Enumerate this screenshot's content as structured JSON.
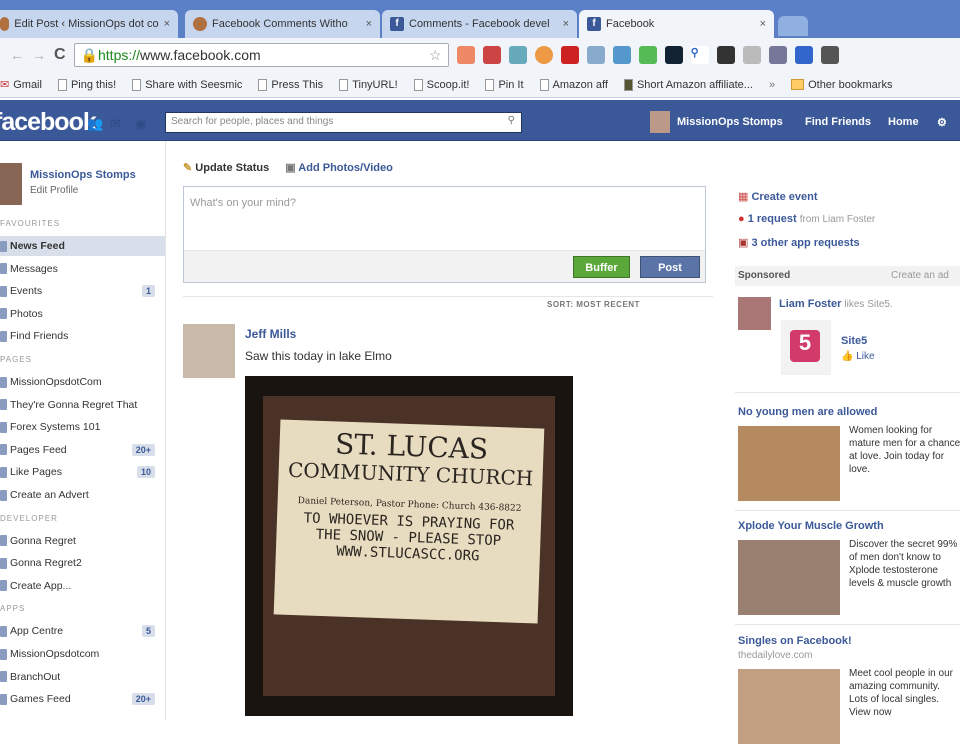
{
  "browser": {
    "tabs": [
      {
        "title": "Edit Post ‹ MissionOps dot co"
      },
      {
        "title": "Facebook Comments Witho"
      },
      {
        "title": "Comments - Facebook devel"
      },
      {
        "title": "Facebook"
      }
    ],
    "url_scheme": "https://",
    "url_rest": "www.facebook.com",
    "bookmarks": [
      "Gmail",
      "Ping this!",
      "Share with Seesmic",
      "Press This",
      "TinyURL!",
      "Scoop.it!",
      "Pin It",
      "Amazon aff",
      "Short Amazon affiliate...",
      "Other bookmarks"
    ]
  },
  "header": {
    "logo": "facebook",
    "search_placeholder": "Search for people, places and things",
    "user": "MissionOps Stomps",
    "find_friends": "Find Friends",
    "home": "Home"
  },
  "sidebar": {
    "profile_name": "MissionOps Stomps",
    "edit_profile": "Edit Profile",
    "sections": [
      {
        "title": "Favourites",
        "items": [
          {
            "label": "News Feed"
          },
          {
            "label": "Messages"
          },
          {
            "label": "Events",
            "count": "1"
          },
          {
            "label": "Photos"
          },
          {
            "label": "Find Friends"
          }
        ]
      },
      {
        "title": "Pages",
        "items": [
          {
            "label": "MissionOpsdotCom"
          },
          {
            "label": "They're Gonna Regret That"
          },
          {
            "label": "Forex Systems 101"
          },
          {
            "label": "Pages Feed",
            "count": "20+"
          },
          {
            "label": "Like Pages",
            "count": "10"
          },
          {
            "label": "Create an Advert"
          }
        ]
      },
      {
        "title": "Developer",
        "items": [
          {
            "label": "Gonna Regret"
          },
          {
            "label": "Gonna Regret2"
          },
          {
            "label": "Create App..."
          }
        ]
      },
      {
        "title": "Apps",
        "items": [
          {
            "label": "App Centre",
            "count": "5"
          },
          {
            "label": "MissionOpsdotcom"
          },
          {
            "label": "BranchOut"
          },
          {
            "label": "Games Feed",
            "count": "20+"
          }
        ]
      }
    ]
  },
  "composer": {
    "update_status": "Update Status",
    "add_photos": "Add Photos/Video",
    "placeholder": "What's on your mind?",
    "buffer": "Buffer",
    "post": "Post"
  },
  "feed": {
    "sort": "SORT: MOST RECENT",
    "post": {
      "author": "Jeff Mills",
      "text": "Saw this today in lake Elmo",
      "photo_sign": [
        "ST. LUCAS",
        "COMMUNITY CHURCH",
        "Daniel Peterson, Pastor  Phone: Church 436-8822",
        "TO WHOEVER IS PRAYING FOR",
        "THE SNOW - PLEASE STOP",
        "WWW.STLUCASCC.ORG"
      ]
    }
  },
  "right": {
    "create_event": "Create event",
    "request": "1 request",
    "request_from": "from Liam Foster",
    "app_requests": "3 other app requests",
    "sponsored": "Sponsored",
    "create_ad": "Create an ad",
    "liam": "Liam Foster",
    "likes": "likes Site5.",
    "site5": "Site5",
    "like": "Like",
    "ads": [
      {
        "title": "No young men are allowed",
        "domain": "",
        "body": "Women looking for mature men for a chance at love. Join today for love."
      },
      {
        "title": "Xplode Your Muscle Growth",
        "domain": "",
        "body": "Discover the secret 99% of men don't know to Xplode testosterone levels & muscle growth"
      },
      {
        "title": "Singles on Facebook!",
        "domain": "thedailylove.com",
        "body": "Meet cool people in our amazing community. Lots of local singles. View now"
      }
    ]
  }
}
